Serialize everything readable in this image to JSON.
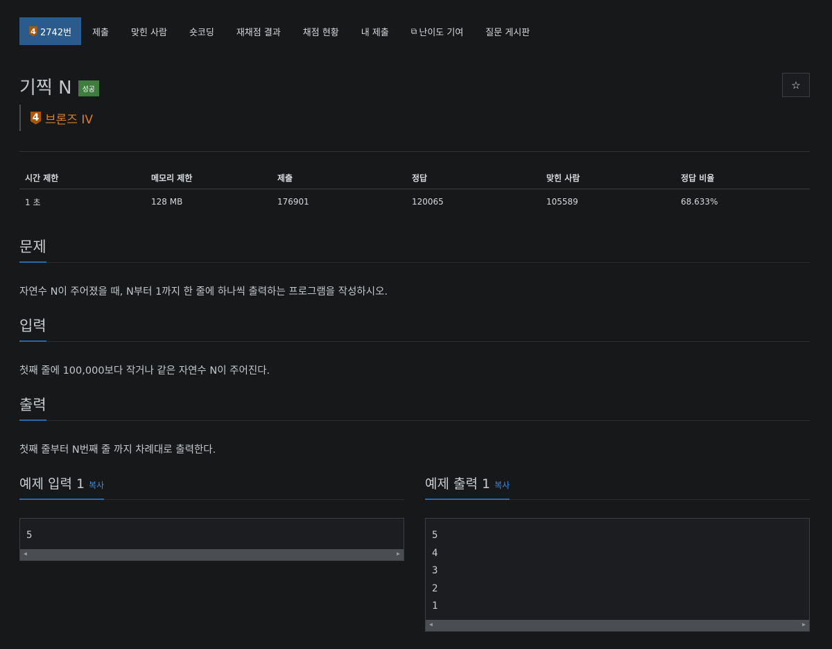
{
  "nav": {
    "problem_tier": "4",
    "items": [
      {
        "label": "2742번"
      },
      {
        "label": "제출"
      },
      {
        "label": "맞힌 사람"
      },
      {
        "label": "숏코딩"
      },
      {
        "label": "재채점 결과"
      },
      {
        "label": "채점 현황"
      },
      {
        "label": "내 제출"
      },
      {
        "label": "난이도 기여"
      },
      {
        "label": "질문 게시판"
      }
    ]
  },
  "problem": {
    "title": "기찍 N",
    "status": "성공",
    "star_icon": "☆",
    "tier_number": "4",
    "tier_label": "브론즈 IV"
  },
  "info_table": {
    "headers": [
      "시간 제한",
      "메모리 제한",
      "제출",
      "정답",
      "맞힌 사람",
      "정답 비율"
    ],
    "row": [
      "1 초",
      "128 MB",
      "176901",
      "120065",
      "105589",
      "68.633%"
    ]
  },
  "sections": {
    "description": {
      "title": "문제",
      "body": "자연수 N이 주어졌을 때, N부터 1까지 한 줄에 하나씩 출력하는 프로그램을 작성하시오."
    },
    "input": {
      "title": "입력",
      "body": "첫째 줄에 100,000보다 작거나 같은 자연수 N이 주어진다."
    },
    "output": {
      "title": "출력",
      "body": "첫째 줄부터 N번째 줄 까지 차례대로 출력한다."
    }
  },
  "samples": {
    "copy_label": "복사",
    "input": {
      "title": "예제 입력 1",
      "lines": [
        "5"
      ]
    },
    "output": {
      "title": "예제 출력 1",
      "lines": [
        "5",
        "4",
        "3",
        "2",
        "1"
      ]
    }
  },
  "colors": {
    "background": "#17181a",
    "accent": "#2a5b8c",
    "success": "#3f7d3f",
    "bronze": "#ad5600",
    "link": "#3d8be0"
  }
}
